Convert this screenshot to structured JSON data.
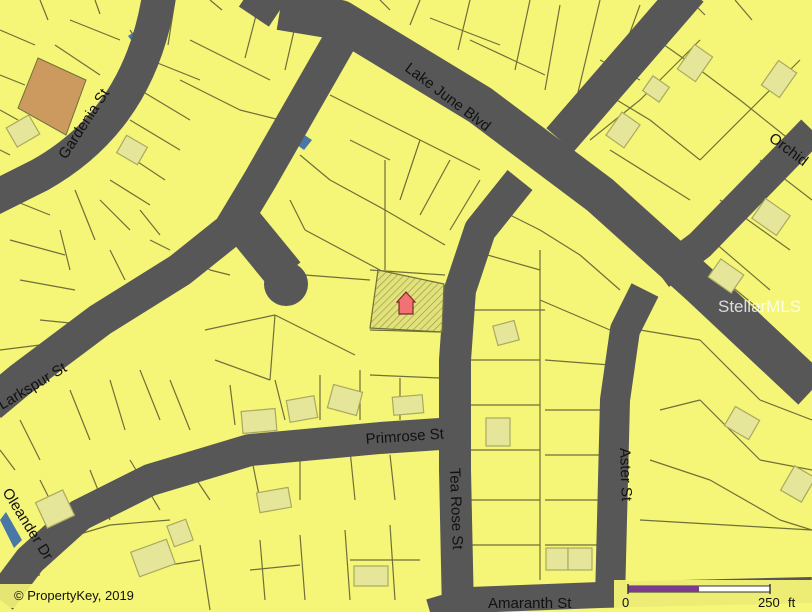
{
  "colors": {
    "parcel": "#f5f578",
    "road": "#575757",
    "lot_line": "#6f6f3a",
    "building": "#e6e69a",
    "building_stroke": "#a9a960",
    "highlight": "#d8d86a",
    "marker": "#f07272",
    "water": "#4a78a6",
    "brown_parcel": "#cc9a5e"
  },
  "streets": {
    "lake_june": "Lake June Blvd",
    "gardenia": "Gardenia St",
    "orchid": "Orchid",
    "larkspur": "Larkspur St",
    "primrose": "Primrose St",
    "tea_rose": "Tea Rose St",
    "aster": "Aster St",
    "oleander": "Oleander Dr",
    "amaranth": "Amaranth St"
  },
  "copyright": "© PropertyKey, 2019",
  "watermark": "StellarMLS",
  "scale": {
    "start": "0",
    "end": "250",
    "unit": "ft"
  },
  "icons": {
    "subject": "home-marker-icon"
  }
}
